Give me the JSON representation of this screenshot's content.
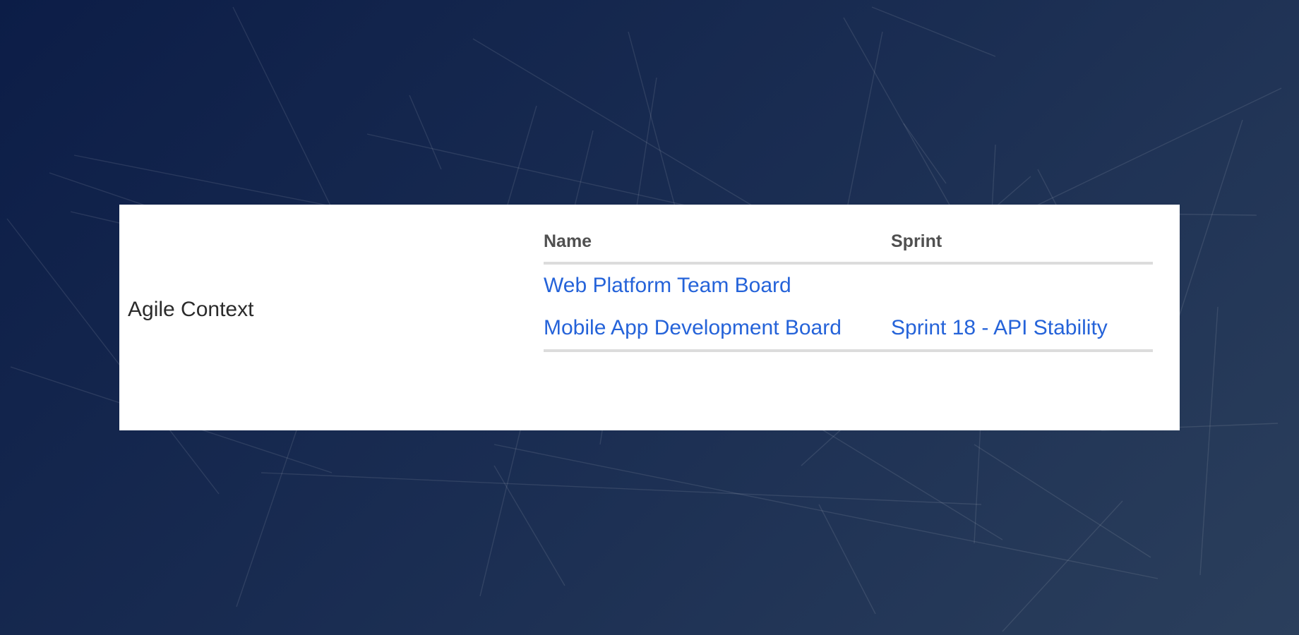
{
  "context": {
    "label": "Agile Context"
  },
  "table": {
    "headers": {
      "name": "Name",
      "sprint": "Sprint"
    },
    "rows": [
      {
        "name": "Web Platform Team Board",
        "sprint": ""
      },
      {
        "name": "Mobile App Development Board",
        "sprint": "Sprint 18 - API Stability"
      }
    ]
  },
  "colors": {
    "link": "#2563d9",
    "header_text": "#505050",
    "label_text": "#2b2b2b",
    "rule": "#dcdcdc",
    "panel_bg": "#ffffff",
    "page_bg_start": "#0c1d47",
    "page_bg_end": "#2b3f5c"
  }
}
